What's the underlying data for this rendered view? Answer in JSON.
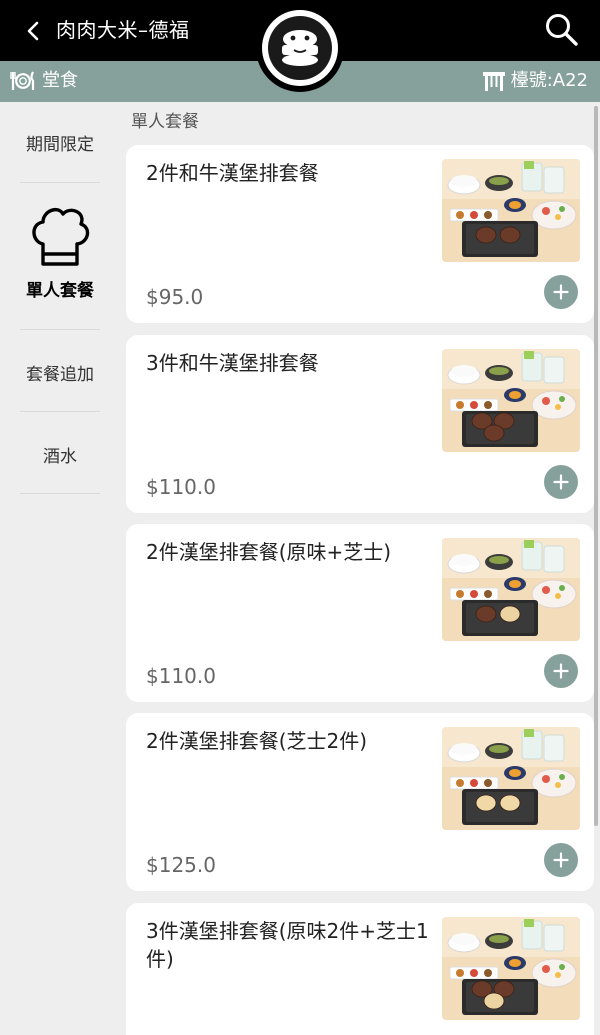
{
  "header": {
    "store_name": "肉肉大米–德福"
  },
  "subbar": {
    "dine_label": "堂食",
    "table_label": "檯號:A22"
  },
  "sidebar": {
    "items": [
      {
        "label": "期間限定"
      },
      {
        "label": "單人套餐",
        "icon": "chef-hat-icon",
        "active": true
      },
      {
        "label": "套餐追加"
      },
      {
        "label": "酒水"
      }
    ]
  },
  "section": {
    "title": "單人套餐"
  },
  "menu": [
    {
      "name": "2件和牛漢堡排套餐",
      "price": "$95.0",
      "patties": 2,
      "patty_style": "plain"
    },
    {
      "name": "3件和牛漢堡排套餐",
      "price": "$110.0",
      "patties": 3,
      "patty_style": "plain"
    },
    {
      "name": "2件漢堡排套餐(原味+芝士)",
      "price": "$110.0",
      "patties": 2,
      "patty_style": "mixed"
    },
    {
      "name": "2件漢堡排套餐(芝士2件)",
      "price": "$125.0",
      "patties": 2,
      "patty_style": "cheese"
    },
    {
      "name": "3件漢堡排套餐(原味2件+芝士1件)",
      "price": "",
      "patties": 3,
      "patty_style": "mixed"
    }
  ],
  "colors": {
    "accent": "#86a09c",
    "header_bg": "#000000",
    "card_bg": "#ffffff"
  }
}
